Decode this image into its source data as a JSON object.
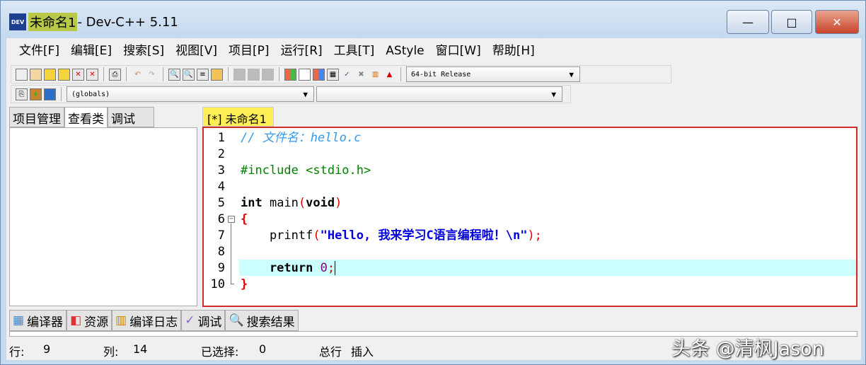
{
  "window": {
    "logo": "DEV",
    "title_highlight": "未命名1",
    "title_rest": " - Dev-C++ 5.11",
    "minimize": "—",
    "maximize": "□",
    "close": "✕"
  },
  "menu": [
    "文件[F]",
    "编辑[E]",
    "搜索[S]",
    "视图[V]",
    "项目[P]",
    "运行[R]",
    "工具[T]",
    "AStyle",
    "窗口[W]",
    "帮助[H]"
  ],
  "toolbar": {
    "compiler_select": "64-bit Release",
    "scope_select": "(globals)",
    "symbol_select": ""
  },
  "left_tabs": [
    "项目管理",
    "查看类",
    "调试"
  ],
  "editor_tab": "[*] 未命名1",
  "code": {
    "line_numbers": [
      "1",
      "2",
      "3",
      "4",
      "5",
      "6",
      "7",
      "8",
      "9",
      "10"
    ],
    "l1": "// 文件名：hello.c",
    "l3": "#include <stdio.h>",
    "l5a": "int",
    "l5b": " main",
    "l5c": "(",
    "l5d": "void",
    "l5e": ")",
    "l6": "{",
    "l7a": "    printf",
    "l7b": "(",
    "l7c": "\"Hello, 我来学习C语言编程啦！\\n\"",
    "l7d": ");",
    "l9a": "    return",
    "l9b": " 0",
    "l9c": ";",
    "l10": "}"
  },
  "bottom_tabs": [
    "编译器",
    "资源",
    "编译日志",
    "调试",
    "搜索结果"
  ],
  "status": {
    "row_label": "行:",
    "row": "9",
    "col_label": "列:",
    "col": "14",
    "sel_label": "已选择:",
    "sel": "0",
    "total_label": "总行",
    "mode": "插入"
  },
  "watermark": "头条 @清枫Jason"
}
